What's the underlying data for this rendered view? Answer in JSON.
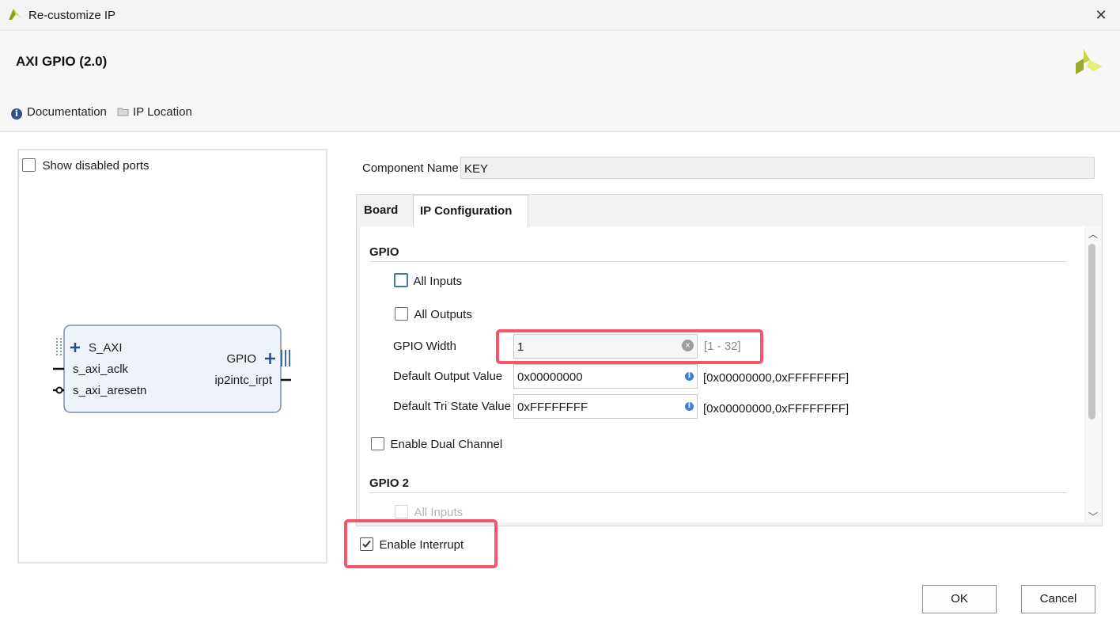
{
  "window": {
    "title": "Re-customize IP",
    "close": "✕"
  },
  "header": {
    "ip_title": "AXI GPIO (2.0)",
    "documentation": "Documentation",
    "ip_location": "IP Location"
  },
  "preview": {
    "show_disabled_ports": "Show disabled ports",
    "show_disabled_checked": false,
    "block": {
      "left_ports": [
        "S_AXI",
        "s_axi_aclk",
        "s_axi_aresetn"
      ],
      "right_ports": [
        "GPIO",
        "ip2intc_irpt"
      ]
    }
  },
  "component": {
    "label": "Component Name",
    "value": "KEY"
  },
  "tabs": [
    {
      "label": "Board",
      "active": false
    },
    {
      "label": "IP Configuration",
      "active": true
    }
  ],
  "gpio": {
    "title": "GPIO",
    "all_inputs": "All Inputs",
    "all_outputs": "All Outputs",
    "width_label": "GPIO Width",
    "width_value": "1",
    "width_range": "[1 - 32]",
    "default_output_label": "Default Output Value",
    "default_output_value": "0x00000000",
    "default_output_range": "[0x00000000,0xFFFFFFFF]",
    "default_tri_label": "Default Tri State Value",
    "default_tri_value": "0xFFFFFFFF",
    "default_tri_range": "[0x00000000,0xFFFFFFFF]"
  },
  "dual_channel": "Enable Dual Channel",
  "gpio2": {
    "title": "GPIO 2",
    "all_inputs": "All Inputs"
  },
  "interrupt": {
    "label": "Enable Interrupt",
    "checked": true
  },
  "buttons": {
    "ok": "OK",
    "cancel": "Cancel"
  },
  "colors": {
    "highlight": "#f2566c",
    "accent": "#2f4f8f",
    "logo": "#b7c934"
  }
}
